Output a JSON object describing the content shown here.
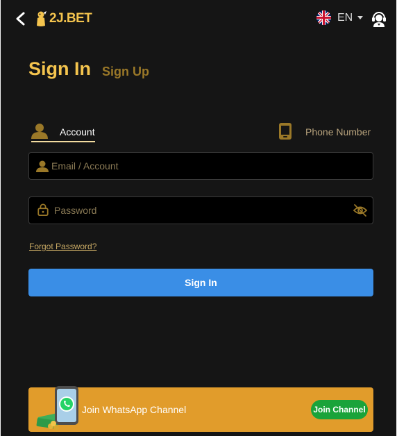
{
  "header": {
    "logo_text": "2J.BET",
    "language": "EN",
    "icons": {
      "back": "back-chevron-icon",
      "flag": "uk-flag-icon",
      "caret": "caret-down-icon",
      "support": "customer-support-icon"
    }
  },
  "titles": {
    "sign_in": "Sign In",
    "sign_up": "Sign Up"
  },
  "tabs": [
    {
      "label": "Account",
      "active": true,
      "icon": "user-icon"
    },
    {
      "label": "Phone Number",
      "active": false,
      "icon": "phone-icon"
    }
  ],
  "form": {
    "email_placeholder": "Email / Account",
    "email_value": "",
    "password_placeholder": "Password",
    "password_value": "",
    "forgot_label": "Forgot Password?",
    "submit_label": "Sign In"
  },
  "whatsapp": {
    "text": "Join WhatsApp Channel",
    "button_label": "Join Channel"
  },
  "colors": {
    "background": "#151515",
    "gold": "#f4c44e",
    "primary_button": "#3a8ee6",
    "banner": "#e19c2b",
    "whatsapp_green": "#1aa33a"
  }
}
